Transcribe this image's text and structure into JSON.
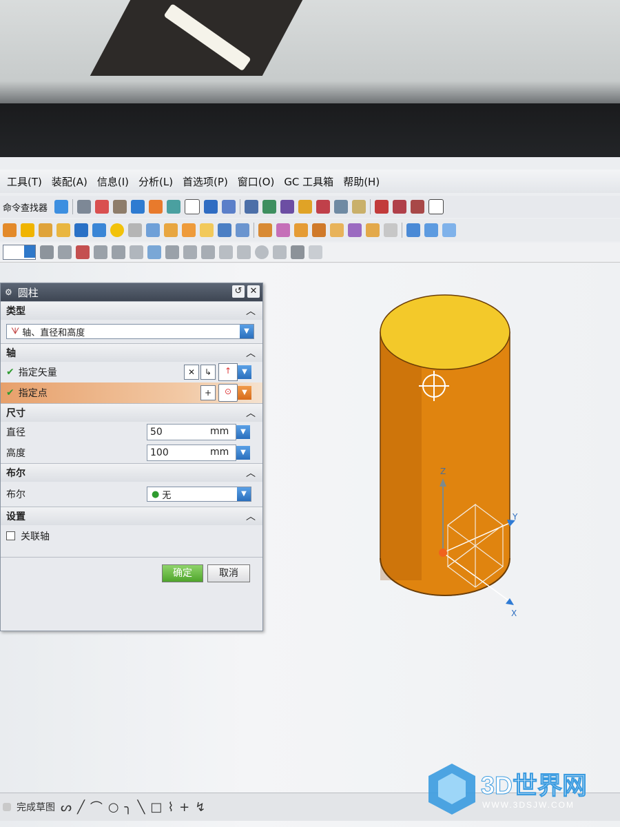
{
  "menu": {
    "items": [
      "工具(T)",
      "装配(A)",
      "信息(I)",
      "分析(L)",
      "首选项(P)",
      "窗口(O)",
      "GC 工具箱",
      "帮助(H)"
    ]
  },
  "toolbar": {
    "command_finder": "命令查找器"
  },
  "dialog": {
    "title": "圆柱",
    "sections": {
      "type": {
        "header": "类型",
        "value": "轴、直径和高度"
      },
      "axis": {
        "header": "轴",
        "vector_label": "指定矢量",
        "point_label": "指定点"
      },
      "dimensions": {
        "header": "尺寸",
        "diameter_label": "直径",
        "diameter_value": "50",
        "diameter_unit": "mm",
        "height_label": "高度",
        "height_value": "100",
        "height_unit": "mm"
      },
      "boolean": {
        "header": "布尔",
        "label": "布尔",
        "value": "无"
      },
      "settings": {
        "header": "设置",
        "associative_axis_label": "关联轴"
      }
    },
    "ok_label": "确定",
    "cancel_label": "取消"
  },
  "viewport": {
    "axes": {
      "z": "Z",
      "y": "Y",
      "x": "X"
    },
    "cylinder_colors": {
      "side": "#e0840f",
      "top": "#f3c92a",
      "edge": "#6b3d07"
    }
  },
  "statusbar": {
    "finish_sketch": "完成草图"
  },
  "watermark": {
    "brand": "3D世界网",
    "url": "WWW.3DSJW.COM"
  }
}
